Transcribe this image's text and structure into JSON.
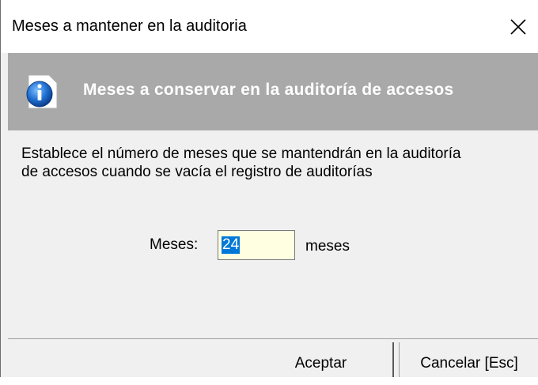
{
  "window": {
    "title": "Meses a mantener en la auditoria"
  },
  "banner": {
    "icon": "info-icon",
    "title": "Meses a conservar en la auditoría de accesos"
  },
  "description": {
    "line1": "Establece el número de meses que se mantendrán en la auditoría",
    "line2": "de accesos cuando se vacía el registro de auditorías"
  },
  "form": {
    "label": "Meses:",
    "value": "24",
    "unit": "meses"
  },
  "buttons": {
    "ok_label": "Aceptar",
    "cancel_label": "Cancelar [Esc]"
  },
  "colors": {
    "banner_bg": "#a9a9a9",
    "input_bg": "#ffffe1",
    "selection": "#0078d7"
  }
}
